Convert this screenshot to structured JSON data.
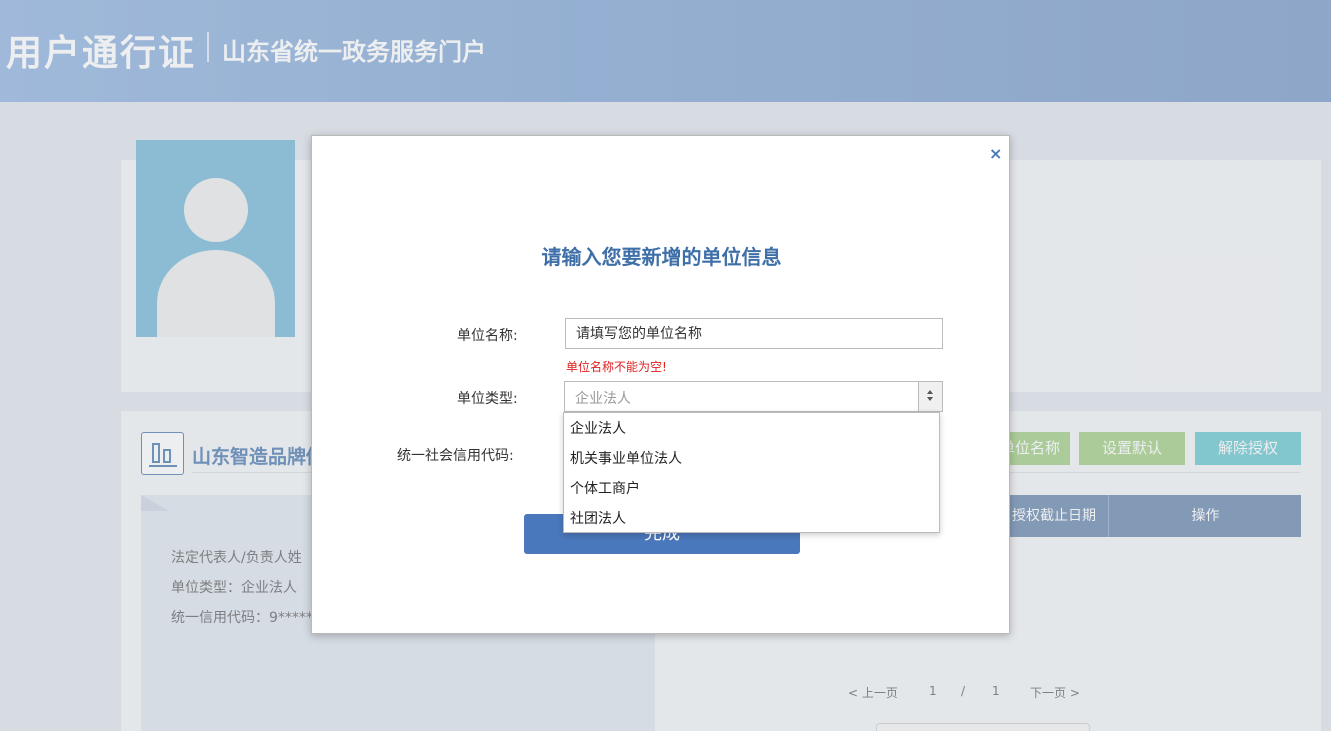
{
  "header": {
    "brand": "用户通行证",
    "portal": "山东省统一政务服务门户"
  },
  "unit": {
    "name": "山东智造品牌價",
    "buttons": {
      "edit": "单位名称",
      "set_default": "设置默认",
      "revoke": "解除授权"
    },
    "details": {
      "legal_rep": "法定代表人/负责人姓",
      "type": "单位类型：企业法人",
      "credit_code": "统一信用代码：9*****"
    },
    "table_headers": [
      "授权截止日期",
      "操作"
    ]
  },
  "pager": {
    "prev": "< 上一页",
    "current": "1",
    "sep": "/",
    "total": "1",
    "next": "下一页 >"
  },
  "modal": {
    "close": "×",
    "title": "请输入您要新增的单位信息",
    "name_label": "单位名称:",
    "name_placeholder": "请填写您的单位名称",
    "name_error": "单位名称不能为空!",
    "type_label": "单位类型:",
    "type_selected": "企业法人",
    "type_options": [
      "企业法人",
      "机关事业单位法人",
      "个体工商户",
      "社团法人"
    ],
    "credit_label": "统一社会信用代码:",
    "done_button": "完成"
  }
}
